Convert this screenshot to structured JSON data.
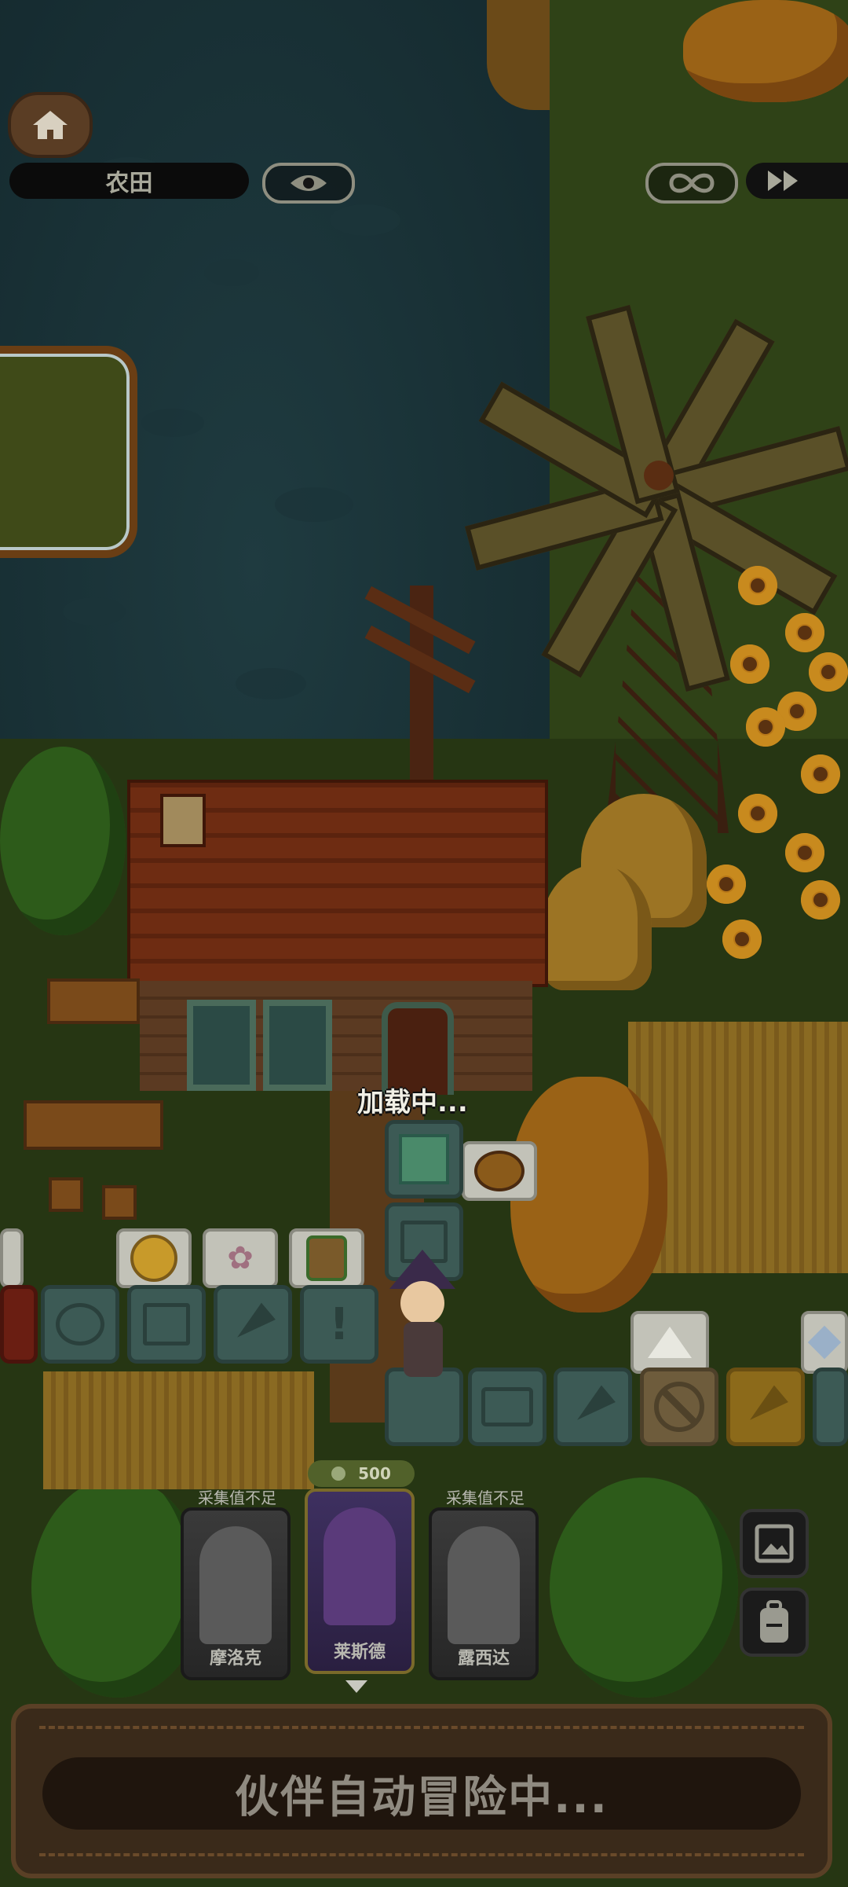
{
  "hud": {
    "location": "农田",
    "home_icon": "home-icon",
    "eye_icon": "eye-icon",
    "infinity_icon": "infinity-icon",
    "fast_forward_icon": "fast-forward-icon"
  },
  "scene": {
    "loading_text": "加载中..."
  },
  "tiles": {
    "upper_row": [
      "coin-icon",
      "blossom-branch-icon",
      "seed-bag-icon"
    ],
    "lower_row": [
      "cat-face-icon",
      "gift-icon",
      "carrot-icon",
      "exclamation-icon"
    ],
    "path_col": [
      "map-icon",
      "gift-icon"
    ],
    "bottom_row": [
      "chest-icon",
      "carrot-icon",
      "no-entry-icon",
      "carrot-icon"
    ],
    "floating": [
      "pot-icon",
      "rice-ball-icon",
      "crystal-icon"
    ]
  },
  "party": {
    "cards": [
      {
        "name": "摩洛克",
        "status": "采集值不足",
        "active": false
      },
      {
        "name": "莱斯德",
        "cost": "500",
        "active": true
      },
      {
        "name": "露西达",
        "status": "采集值不足",
        "active": false
      }
    ]
  },
  "side_buttons": [
    "gallery-icon",
    "backpack-icon"
  ],
  "footer": {
    "status": "伙伴自动冒险中..."
  },
  "colors": {
    "water": "#162c31",
    "panel": "#3a2a1a",
    "accent_gold": "#8c6a1a"
  }
}
